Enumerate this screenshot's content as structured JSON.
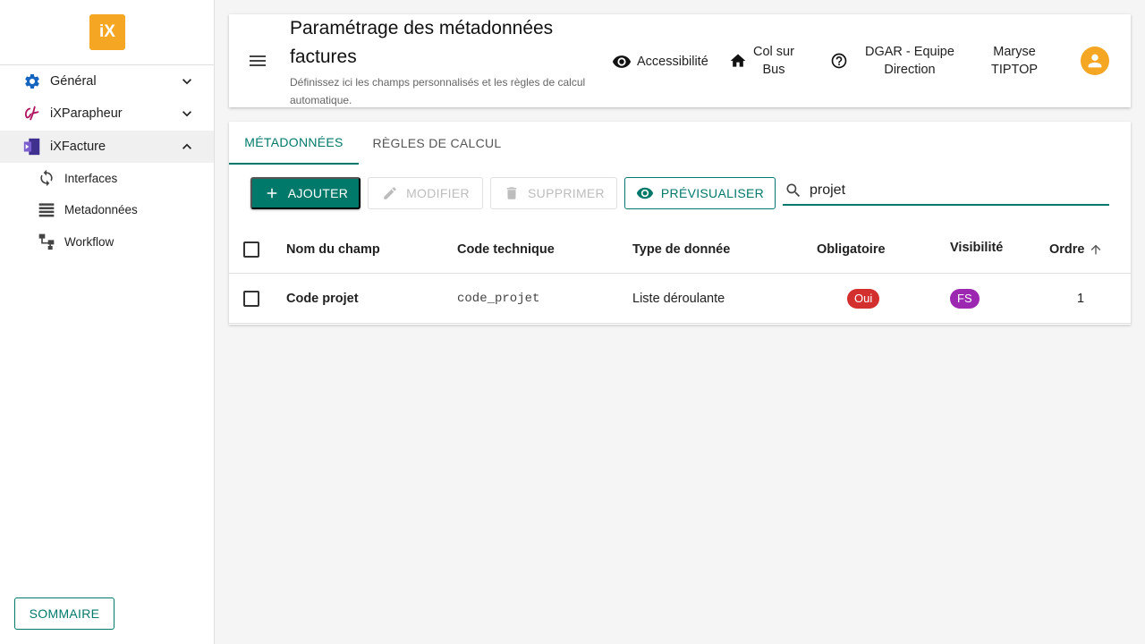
{
  "logo": {
    "text": "iX"
  },
  "sidebar": {
    "items": [
      {
        "label": "Général",
        "icon": "gear-icon",
        "expanded": false
      },
      {
        "label": "iXParapheur",
        "icon": "signature-icon",
        "expanded": false
      },
      {
        "label": "iXFacture",
        "icon": "invoice-icon",
        "expanded": true
      }
    ],
    "subitems": [
      {
        "label": "Interfaces",
        "icon": "sync-icon"
      },
      {
        "label": "Metadonnées",
        "icon": "list-icon"
      },
      {
        "label": "Workflow",
        "icon": "workflow-icon"
      }
    ],
    "sommaire_label": "SOMMAIRE"
  },
  "header": {
    "title": "Paramétrage des métadonnées factures",
    "subtitle": "Définissez ici les champs personnalisés et les règles de calcul automatique.",
    "accessibility": "Accessibilité",
    "home_line1": "Col sur",
    "home_line2": "Bus",
    "help_line1": "DGAR - Equipe",
    "help_line2": "Direction",
    "user_line1": "Maryse",
    "user_line2": "TIPTOP"
  },
  "tabs": [
    {
      "label": "MÉTADONNÉES",
      "active": true
    },
    {
      "label": "RÈGLES DE CALCUL",
      "active": false
    }
  ],
  "toolbar": {
    "add": "AJOUTER",
    "edit": "MODIFIER",
    "delete": "SUPPRIMER",
    "preview": "PRÉVISUALISER"
  },
  "search": {
    "value": "projet"
  },
  "table": {
    "columns": {
      "name": "Nom du champ",
      "code": "Code technique",
      "type": "Type de donnée",
      "required": "Obligatoire",
      "visibility": "Visibilité",
      "order": "Ordre"
    },
    "rows": [
      {
        "name": "Code projet",
        "code": "code_projet",
        "type": "Liste déroulante",
        "required": "Oui",
        "visibility": "FS",
        "order": "1"
      }
    ]
  },
  "colors": {
    "primary": "#00796b",
    "accent": "#f5a623",
    "required_chip": "#d32f2f",
    "visibility_chip": "#9c27b0"
  }
}
